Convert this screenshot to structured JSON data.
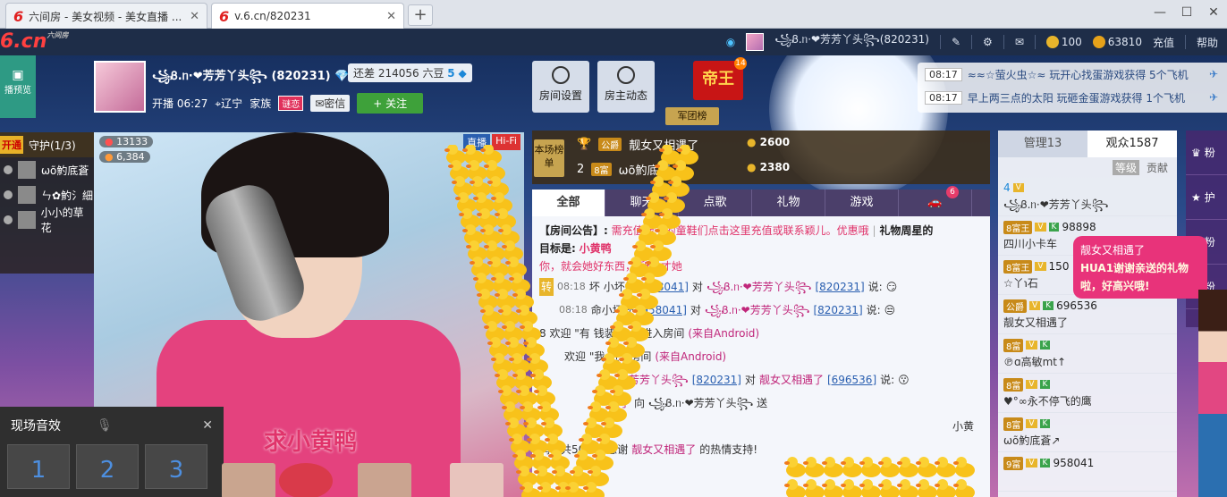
{
  "browser": {
    "tabs": [
      {
        "label": "六间房 - 美女视频 - 美女直播 ..."
      },
      {
        "label": "v.6.cn/820231"
      }
    ],
    "newtab": "+",
    "controls": [
      "—",
      "☐",
      "✕"
    ]
  },
  "site": {
    "brand": "6.cn",
    "brand_small": "六间房",
    "user_name": "꧁Ᏸ.ᥒ·❤芳芳丫头꧂(820231)",
    "coins": "100",
    "beans": "63810",
    "recharge": "充值",
    "help": "帮助"
  },
  "left": {
    "live_preview": "播预览"
  },
  "host": {
    "name": "꧁Ᏸ.ᥒ·❤芳芳丫头꧂ (820231)",
    "rich_text": "还差 214056 六豆",
    "rich_level": "5",
    "start_time": "开播 06:27",
    "location": "辽宁",
    "family": "家族",
    "family_badge": "谜恋",
    "message": "密信",
    "follow": "+ 关注"
  },
  "room_buttons": {
    "settings": "房间设置",
    "dynamics": "房主动态"
  },
  "emperor": {
    "label": "帝王",
    "count": "14",
    "army": "军团榜"
  },
  "ticker": [
    {
      "time": "08:17",
      "text": "≈≈☆萤火虫☆≈ 玩开心找蛋游戏获得 5个飞机"
    },
    {
      "time": "08:17",
      "text": "早上两三点的太阳 玩砸金蛋游戏获得 1个飞机"
    }
  ],
  "guard": {
    "open": "开通",
    "title": "守护(1/3)",
    "members": [
      "ωõ魡底蒼",
      "ㄣ✿魡氵細",
      "小小的草花"
    ]
  },
  "video": {
    "live": "直播",
    "hifi": "Hi-Fi",
    "wealth": "13133",
    "fans": "6,384",
    "caption": "求小黄鸭"
  },
  "effects": {
    "title": "现场音效",
    "close": "✕",
    "keys": [
      "1",
      "2",
      "3"
    ]
  },
  "ranking": {
    "tag": "本场榜单",
    "rows": [
      {
        "rank": "1",
        "level": "公爵",
        "name": "靓女又相遇了",
        "value": "2600"
      },
      {
        "rank": "2",
        "level": "8富",
        "name": "ωõ魡底蒼",
        "value": "2380"
      }
    ]
  },
  "chat": {
    "tabs": [
      "全部",
      "聊天",
      "点歌",
      "礼物",
      "游戏"
    ],
    "car_count": "6",
    "notice_label": "【房间公告】:",
    "notice_text": "需充值绿卡的童鞋们点击这里充值或联系颖儿。优惠哦",
    "notice_gift": "礼物周星的",
    "target_label": "目标是:",
    "target_text": "小黄鸭",
    "notice_line3": "你，就会她好东西，",
    "notice_line3b": "所以才她",
    "messages": [
      {
        "tag": "转",
        "time": "08:18",
        "from_short": "坏",
        "from_tail": "小坏坏",
        "from_id": "[958041]",
        "verb": "对",
        "to": "꧁Ᏸ.ᥒ·❤芳芳丫头꧂",
        "to_id": "[820231]",
        "end": "说:"
      },
      {
        "tag": "",
        "time": "08:18",
        "from_short": "",
        "from_tail": "命小坏坏",
        "from_id": "[958041]",
        "verb": "对",
        "to": "꧁Ᏸ.ᥒ·❤芳芳丫头꧂",
        "to_id": "[820231]",
        "end": "说:"
      }
    ],
    "welcome1_pre": "8 欢迎 \"有",
    "welcome1_mid": "钱装逼。\"进入房间",
    "welcome1_src": "(来自Android)",
    "welcome2_pre": "欢迎 \"我",
    "welcome2_mid": "进入房间",
    "welcome2_src": "(来自Android)",
    "line_from": "芳芳丫头꧂",
    "line_from_id": "[820231]",
    "line_verb": "对",
    "line_to": "靓女又相遇了",
    "line_to_id": "[696536]",
    "line_end": "说:",
    "gift_from": "遇了",
    "gift_to": "向 ꧁Ᏸ.ᥒ·❤芳芳丫头꧂ 送",
    "gift_tail": "小黄",
    "thanks_pre": "鸭，共50个，感谢",
    "thanks_name": "靓女又相遇了",
    "thanks_end": "的热情支持!"
  },
  "userlist": {
    "tabs": [
      "管理13",
      "观众1587"
    ],
    "level": "等级",
    "contrib": "贡献",
    "items": [
      {
        "badge": "4",
        "name": "꧁Ᏸ.ᥒ·❤芳芳丫头꧂"
      },
      {
        "badge": "8富王",
        "name": "四川小卡车",
        "id": "98898"
      },
      {
        "badge": "8富王",
        "name": "☆丫℩石",
        "id": "150"
      },
      {
        "badge": "公爵",
        "name": "靓女又相遇了",
        "id": "696536"
      },
      {
        "badge": "8富",
        "name": "℗ɑ高敏mt↑"
      },
      {
        "badge": "8富",
        "name": "♥°∞永不停飞的鹰"
      },
      {
        "badge": "8富",
        "name": "ωõ魡底蒼↗"
      },
      {
        "badge": "9富",
        "name": "",
        "id": "958041"
      }
    ]
  },
  "bubble": {
    "line1": "靓女又相遇了",
    "line2": "HUA1谢谢亲送的礼物啦，好高兴哦!"
  },
  "rightstrip": [
    "粉",
    "护",
    "粉",
    "粉"
  ]
}
